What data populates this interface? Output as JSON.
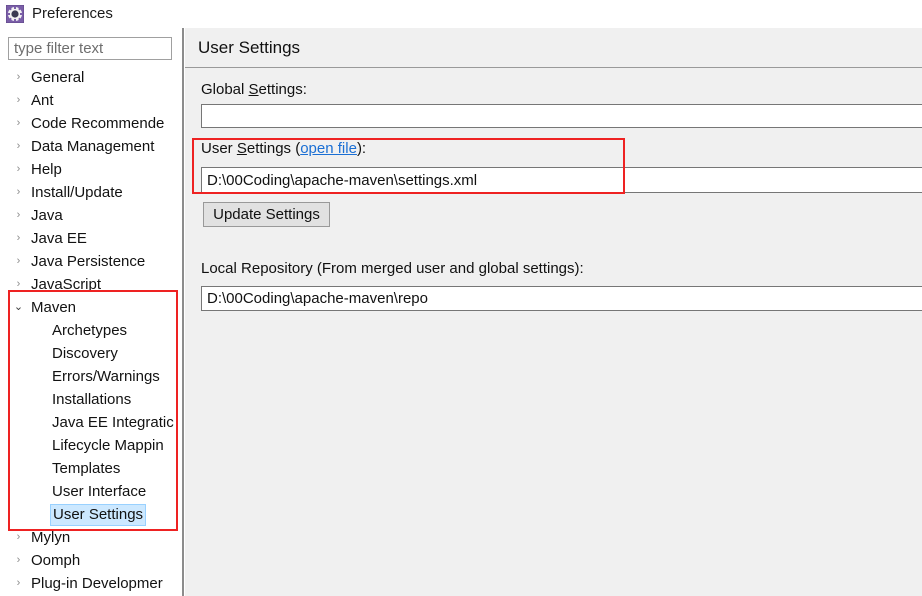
{
  "window": {
    "title": "Preferences",
    "icon": "preferences-gear-icon"
  },
  "sidebar": {
    "filter": {
      "value": "",
      "placeholder": "type filter text"
    },
    "items": [
      {
        "label": "General",
        "level": 0,
        "state": "collapsed",
        "selected": false
      },
      {
        "label": "Ant",
        "level": 0,
        "state": "collapsed",
        "selected": false
      },
      {
        "label": "Code Recommende",
        "level": 0,
        "state": "collapsed",
        "selected": false
      },
      {
        "label": "Data Management",
        "level": 0,
        "state": "collapsed",
        "selected": false
      },
      {
        "label": "Help",
        "level": 0,
        "state": "collapsed",
        "selected": false
      },
      {
        "label": "Install/Update",
        "level": 0,
        "state": "collapsed",
        "selected": false
      },
      {
        "label": "Java",
        "level": 0,
        "state": "collapsed",
        "selected": false
      },
      {
        "label": "Java EE",
        "level": 0,
        "state": "collapsed",
        "selected": false
      },
      {
        "label": "Java Persistence",
        "level": 0,
        "state": "collapsed",
        "selected": false
      },
      {
        "label": "JavaScript",
        "level": 0,
        "state": "collapsed",
        "selected": false
      },
      {
        "label": "Maven",
        "level": 0,
        "state": "expanded",
        "selected": false
      },
      {
        "label": "Archetypes",
        "level": 1,
        "state": "leaf",
        "selected": false
      },
      {
        "label": "Discovery",
        "level": 1,
        "state": "leaf",
        "selected": false
      },
      {
        "label": "Errors/Warnings",
        "level": 1,
        "state": "leaf",
        "selected": false
      },
      {
        "label": "Installations",
        "level": 1,
        "state": "leaf",
        "selected": false
      },
      {
        "label": "Java EE Integratic",
        "level": 1,
        "state": "leaf",
        "selected": false
      },
      {
        "label": "Lifecycle Mappin",
        "level": 1,
        "state": "leaf",
        "selected": false
      },
      {
        "label": "Templates",
        "level": 1,
        "state": "leaf",
        "selected": false
      },
      {
        "label": "User Interface",
        "level": 1,
        "state": "leaf",
        "selected": false
      },
      {
        "label": "User Settings",
        "level": 1,
        "state": "leaf",
        "selected": true
      },
      {
        "label": "Mylyn",
        "level": 0,
        "state": "collapsed",
        "selected": false
      },
      {
        "label": "Oomph",
        "level": 0,
        "state": "collapsed",
        "selected": false
      },
      {
        "label": "Plug-in Developmer",
        "level": 0,
        "state": "collapsed",
        "selected": false
      }
    ],
    "glyphs": {
      "collapsed": "›",
      "expanded": "⌄"
    }
  },
  "content": {
    "title": "User Settings",
    "global_settings": {
      "label_before": "Global ",
      "label_mnemonic": "S",
      "label_after": "ettings:",
      "value": "",
      "placeholder": ""
    },
    "user_settings": {
      "label_before": "User ",
      "label_mnemonic": "S",
      "label_middle": "ettings (",
      "link_label": "open file",
      "label_after": "):",
      "value": "D:\\00Coding\\apache-maven\\settings.xml",
      "placeholder": ""
    },
    "update_settings_button": "Update Settings",
    "local_repository": {
      "label": "Local Repository (From merged user and global settings):",
      "value": "D:\\00Coding\\apache-maven\\repo",
      "placeholder": ""
    }
  },
  "annotations": [
    {
      "name": "maven-tree-highlight",
      "color": "#ee2222"
    },
    {
      "name": "user-settings-highlight",
      "color": "#ee2222"
    }
  ],
  "colors": {
    "panel_background": "#f0f0f0",
    "selection": "#cce8ff",
    "link": "#1a6fd4",
    "annotation": "#ee2222"
  }
}
